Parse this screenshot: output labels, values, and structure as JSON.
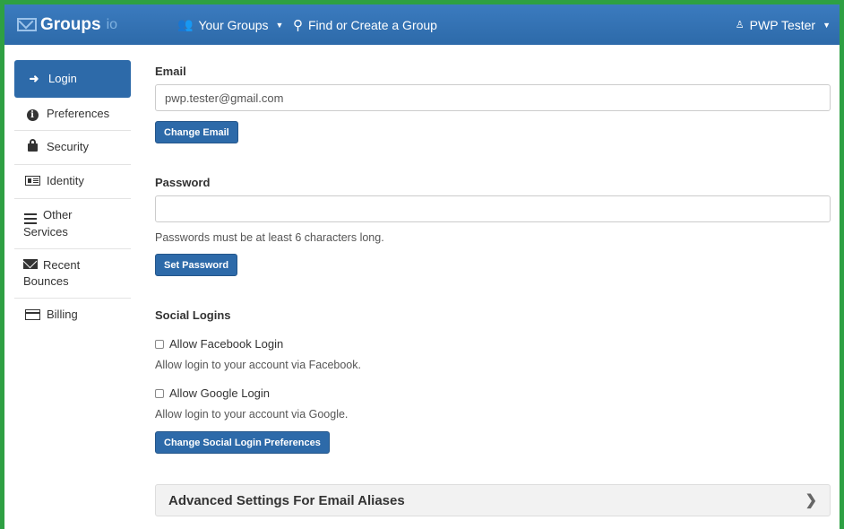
{
  "navbar": {
    "brand": "Groups",
    "brand_suffix": "io",
    "your_groups": "Your Groups",
    "find_group": "Find or Create a Group",
    "user": "PWP Tester"
  },
  "sidebar": {
    "items": [
      {
        "label": "Login",
        "icon": "sign-in-icon",
        "active": true
      },
      {
        "label": "Preferences",
        "icon": "info-circle-icon"
      },
      {
        "label": "Security",
        "icon": "lock-icon"
      },
      {
        "label": "Identity",
        "icon": "id-card-icon"
      },
      {
        "label": "Other",
        "label2": "Services",
        "icon": "bars-icon"
      },
      {
        "label": "Recent",
        "label2": "Bounces",
        "icon": "envelope-icon"
      },
      {
        "label": "Billing",
        "icon": "credit-card-icon"
      }
    ]
  },
  "email": {
    "label": "Email",
    "value": "pwp.tester@gmail.com",
    "button": "Change Email"
  },
  "password": {
    "label": "Password",
    "value": "",
    "help": "Passwords must be at least 6 characters long.",
    "button": "Set Password"
  },
  "social": {
    "label": "Social Logins",
    "facebook_label": "Allow Facebook Login",
    "facebook_help": "Allow login to your account via Facebook.",
    "google_label": "Allow Google Login",
    "google_help": "Allow login to your account via Google.",
    "button": "Change Social Login Preferences"
  },
  "advanced": {
    "label": "Advanced Settings For Email Aliases"
  },
  "colors": {
    "navbar": "#2d6aa9",
    "active": "#2d6aa9",
    "frame": "#2ea043"
  }
}
